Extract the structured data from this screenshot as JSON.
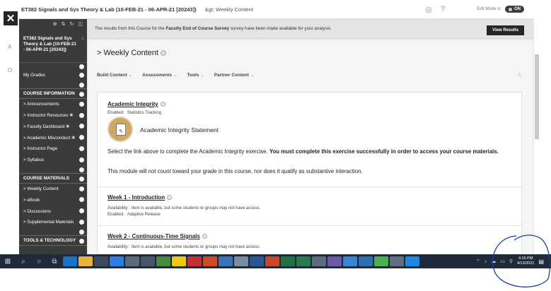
{
  "header": {
    "course_crumb": "ET382 Signals and Sys Theory & Lab (10-FEB-21 - 06-APR-21 [20243])",
    "page_crumb": "&gt; Weekly Content",
    "edit_mode_label": "Edit Mode is:",
    "edit_mode_value": "ON"
  },
  "banner": {
    "text_before": "The results from this Course for the ",
    "survey_name": "Faculty End of Course Survey",
    "text_after": " survey have been made available for your analysis.",
    "button": "View Results"
  },
  "sidebar": {
    "course_title": "ET382 Signals and Sys Theory & Lab (10-FEB-21 - 06-APR-21 [20243])",
    "items": [
      {
        "type": "link",
        "label": "My Grades"
      },
      {
        "type": "header",
        "label": "COURSE INFORMATION"
      },
      {
        "type": "link",
        "label": "> Announcements"
      },
      {
        "type": "link",
        "label": "> Instructor Resources"
      },
      {
        "type": "link",
        "label": "> Faculty Dashboard"
      },
      {
        "type": "link",
        "label": "> Academic Misconduct"
      },
      {
        "type": "link",
        "label": "> Instructor Page"
      },
      {
        "type": "link",
        "label": "> Syllabus"
      },
      {
        "type": "header",
        "label": "COURSE MATERIALS"
      },
      {
        "type": "link",
        "label": "> Weekly Content"
      },
      {
        "type": "link",
        "label": "> eBook"
      },
      {
        "type": "link",
        "label": "> Discussions"
      },
      {
        "type": "link",
        "label": "> Supplemental Materials"
      },
      {
        "type": "header",
        "label": "TOOLS & TECHNOLOGY"
      }
    ]
  },
  "main": {
    "page_title": "> Weekly Content",
    "actions": [
      "Build Content",
      "Assessments",
      "Tools",
      "Partner Content"
    ],
    "items": {
      "ai": {
        "title": "Academic Integrity",
        "enabled_label": "Enabled:",
        "enabled_value": "Statistics Tracking",
        "link_text": "Academic Integrity Statement",
        "desc1_plain": "Select the link above to complete the Academic Integrity exercise. ",
        "desc1_bold": "You must complete this exercise successfully in order to access your course materials.",
        "desc2": "This module will not count toward your grade in this course, nor does it qualify as substantive interaction."
      },
      "w1": {
        "title": "Week 1 - Introduction",
        "availability_label": "Availability:",
        "availability_value": "Item is available, but some students or groups may not have access.",
        "enabled_label": "Enabled:",
        "enabled_value": "Adaptive Release"
      },
      "w2": {
        "title": "Week 2 - Continuous-Time Signals",
        "availability_label": "Availability:",
        "availability_value": "Item is available, but some students or groups may not have access."
      }
    }
  },
  "taskbar": {
    "time": "4:16 PM",
    "date": "4/13/2021"
  },
  "colors": {
    "sidebar_bg": "#3b3b3b",
    "taskbar_bg": "#1f2a3a",
    "annotation": "#1a3fa3"
  }
}
